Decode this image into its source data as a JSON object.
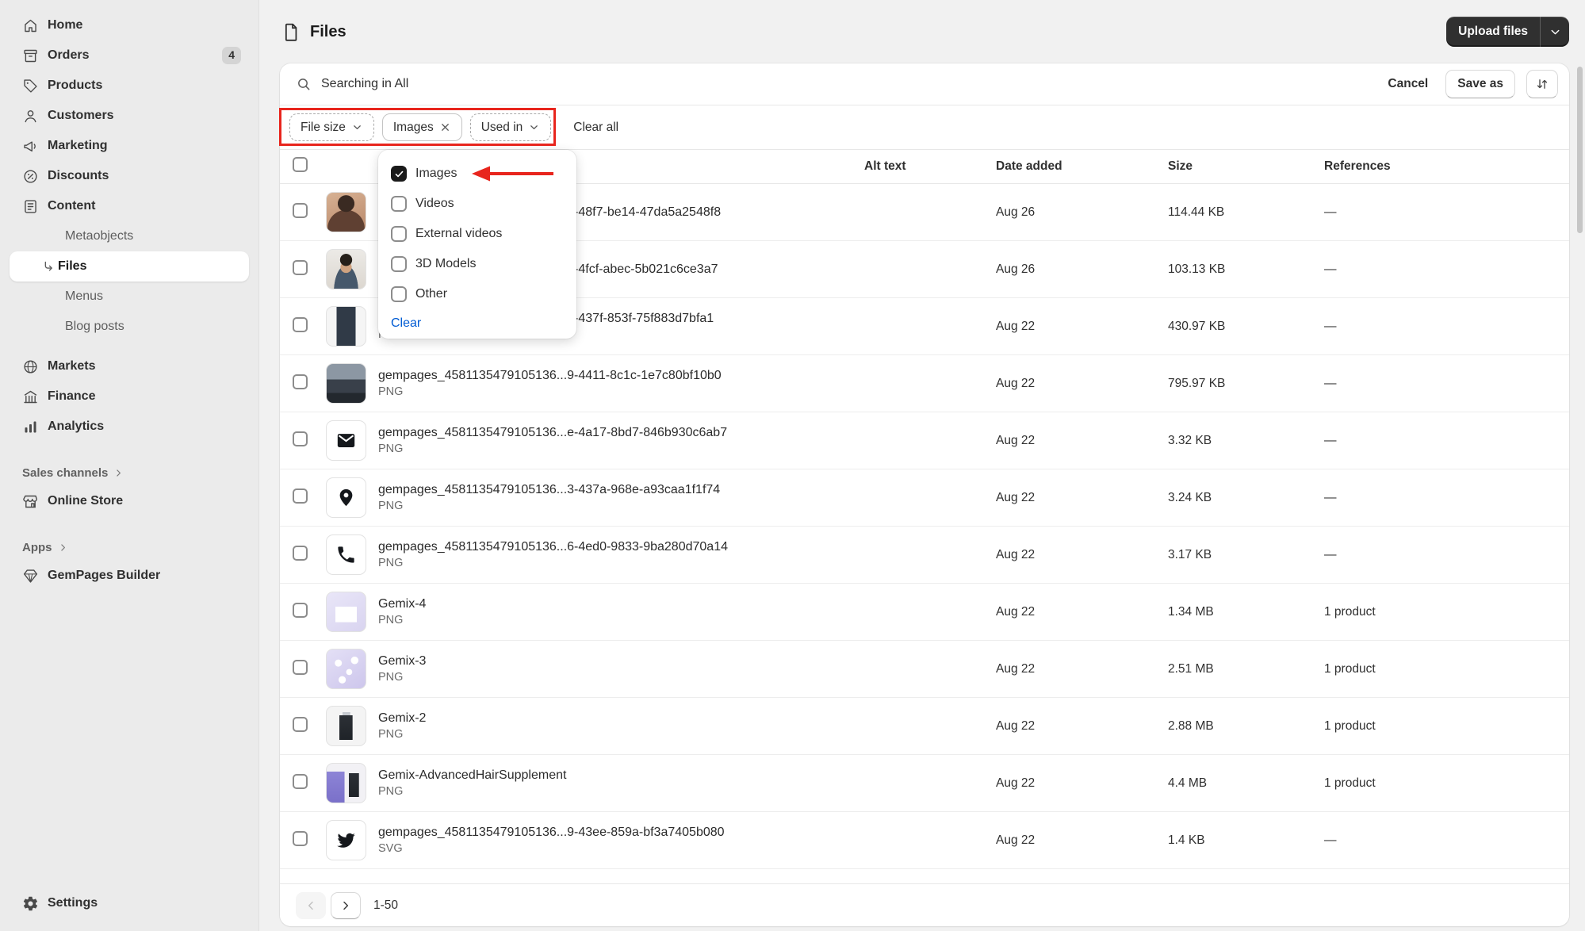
{
  "colors": {
    "annotation_red": "#e8251d",
    "accent_blue": "#005bd3",
    "button_dark": "#303030",
    "sidebar_bg": "#ebebeb",
    "card_bg": "#ffffff"
  },
  "sidebar": {
    "items": [
      {
        "label": "Home",
        "icon": "home"
      },
      {
        "label": "Orders",
        "icon": "orders",
        "badge": "4"
      },
      {
        "label": "Products",
        "icon": "products"
      },
      {
        "label": "Customers",
        "icon": "customers"
      },
      {
        "label": "Marketing",
        "icon": "marketing"
      },
      {
        "label": "Discounts",
        "icon": "discounts"
      },
      {
        "label": "Content",
        "icon": "content"
      },
      {
        "label": "Metaobjects",
        "sub": true
      },
      {
        "label": "Files",
        "sub": true,
        "active": true,
        "icon": "corner-arrow"
      },
      {
        "label": "Menus",
        "sub": true
      },
      {
        "label": "Blog posts",
        "sub": true
      },
      {
        "label": "Markets",
        "icon": "markets",
        "gap": true
      },
      {
        "label": "Finance",
        "icon": "finance"
      },
      {
        "label": "Analytics",
        "icon": "analytics"
      }
    ],
    "sales_channels": {
      "label": "Sales channels",
      "items": [
        {
          "label": "Online Store"
        }
      ]
    },
    "apps": {
      "label": "Apps",
      "items": [
        {
          "label": "GemPages Builder"
        }
      ]
    },
    "settings_label": "Settings"
  },
  "header": {
    "title": "Files",
    "upload_button": "Upload files"
  },
  "search": {
    "value": "Searching in All",
    "cancel": "Cancel",
    "save_as": "Save as"
  },
  "filters": {
    "file_size": "File size",
    "type_chip": "Images",
    "used_in": "Used in",
    "clear_all": "Clear all"
  },
  "type_dropdown": {
    "options": [
      {
        "label": "Images",
        "checked": true
      },
      {
        "label": "Videos",
        "checked": false
      },
      {
        "label": "External videos",
        "checked": false
      },
      {
        "label": "3D Models",
        "checked": false
      },
      {
        "label": "Other",
        "checked": false
      }
    ],
    "clear": "Clear"
  },
  "table": {
    "columns": {
      "alt": "Alt text",
      "date": "Date added",
      "size": "Size",
      "references": "References"
    },
    "rows": [
      {
        "name": "gempages_4581135479105136...e-48f7-be14-47da5a2548f8",
        "type": "",
        "alt": "",
        "date": "Aug 26",
        "size": "114.44 KB",
        "refs": "—",
        "thumb": "photo:avatar-woman"
      },
      {
        "name": "gempages_4581135479105136...1-4fcf-abec-5b021c6ce3a7",
        "type": "",
        "alt": "",
        "date": "Aug 26",
        "size": "103.13 KB",
        "refs": "—",
        "thumb": "photo:avatar-man"
      },
      {
        "name": "gempages_4581135479105136...3-437f-853f-75f883d7bfa1",
        "type": "PNG",
        "alt": "",
        "date": "Aug 22",
        "size": "430.97 KB",
        "refs": "—",
        "thumb": "photo:portrait"
      },
      {
        "name": "gempages_4581135479105136...9-4411-8c1c-1e7c80bf10b0",
        "type": "PNG",
        "alt": "",
        "date": "Aug 22",
        "size": "795.97 KB",
        "refs": "—",
        "thumb": "photo:landscape"
      },
      {
        "name": "gempages_4581135479105136...e-4a17-8bd7-846b930c6ab7",
        "type": "PNG",
        "alt": "",
        "date": "Aug 22",
        "size": "3.32 KB",
        "refs": "—",
        "thumb": "icon:envelope"
      },
      {
        "name": "gempages_4581135479105136...3-437a-968e-a93caa1f1f74",
        "type": "PNG",
        "alt": "",
        "date": "Aug 22",
        "size": "3.24 KB",
        "refs": "—",
        "thumb": "icon:pin"
      },
      {
        "name": "gempages_4581135479105136...6-4ed0-9833-9ba280d70a14",
        "type": "PNG",
        "alt": "",
        "date": "Aug 22",
        "size": "3.17 KB",
        "refs": "—",
        "thumb": "icon:phone"
      },
      {
        "name": "Gemix-4",
        "type": "PNG",
        "alt": "",
        "date": "Aug 22",
        "size": "1.34 MB",
        "refs": "1 product",
        "thumb": "photo:gemix-4"
      },
      {
        "name": "Gemix-3",
        "type": "PNG",
        "alt": "",
        "date": "Aug 22",
        "size": "2.51 MB",
        "refs": "1 product",
        "thumb": "photo:gemix-3"
      },
      {
        "name": "Gemix-2",
        "type": "PNG",
        "alt": "",
        "date": "Aug 22",
        "size": "2.88 MB",
        "refs": "1 product",
        "thumb": "photo:gemix-2"
      },
      {
        "name": "Gemix-AdvancedHairSupplement",
        "type": "PNG",
        "alt": "",
        "date": "Aug 22",
        "size": "4.4 MB",
        "refs": "1 product",
        "thumb": "photo:gemix-adv"
      },
      {
        "name": "gempages_4581135479105136...9-43ee-859a-bf3a7405b080",
        "type": "SVG",
        "alt": "",
        "date": "Aug 22",
        "size": "1.4 KB",
        "refs": "—",
        "thumb": "icon:twitter"
      }
    ]
  },
  "pagination": {
    "range": "1-50"
  }
}
